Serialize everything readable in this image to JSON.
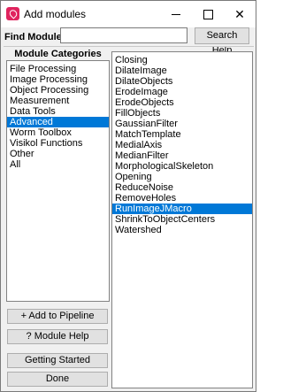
{
  "window": {
    "title": "Add modules"
  },
  "search": {
    "label": "Find Modules:",
    "value": "",
    "button_label": "Search Help"
  },
  "categories": {
    "heading": "Module Categories",
    "items": [
      {
        "label": "File Processing",
        "selected": false
      },
      {
        "label": "Image Processing",
        "selected": false
      },
      {
        "label": "Object Processing",
        "selected": false
      },
      {
        "label": "Measurement",
        "selected": false
      },
      {
        "label": "Data Tools",
        "selected": false
      },
      {
        "label": "Advanced",
        "selected": true
      },
      {
        "label": "Worm Toolbox",
        "selected": false
      },
      {
        "label": "Visikol Functions",
        "selected": false
      },
      {
        "label": "Other",
        "selected": false
      },
      {
        "label": "All",
        "selected": false
      }
    ]
  },
  "modules": {
    "items": [
      {
        "label": "Closing",
        "selected": false
      },
      {
        "label": "DilateImage",
        "selected": false
      },
      {
        "label": "DilateObjects",
        "selected": false
      },
      {
        "label": "ErodeImage",
        "selected": false
      },
      {
        "label": "ErodeObjects",
        "selected": false
      },
      {
        "label": "FillObjects",
        "selected": false
      },
      {
        "label": "GaussianFilter",
        "selected": false
      },
      {
        "label": "MatchTemplate",
        "selected": false
      },
      {
        "label": "MedialAxis",
        "selected": false
      },
      {
        "label": "MedianFilter",
        "selected": false
      },
      {
        "label": "MorphologicalSkeleton",
        "selected": false
      },
      {
        "label": "Opening",
        "selected": false
      },
      {
        "label": "ReduceNoise",
        "selected": false
      },
      {
        "label": "RemoveHoles",
        "selected": false
      },
      {
        "label": "RunImageJMacro",
        "selected": true
      },
      {
        "label": "ShrinkToObjectCenters",
        "selected": false
      },
      {
        "label": "Watershed",
        "selected": false
      }
    ]
  },
  "buttons": {
    "add": "+ Add to Pipeline",
    "help": "? Module Help",
    "getting_started": "Getting Started",
    "done": "Done"
  },
  "colors": {
    "selection": "#0078d7",
    "app_icon": "#e0245e"
  }
}
